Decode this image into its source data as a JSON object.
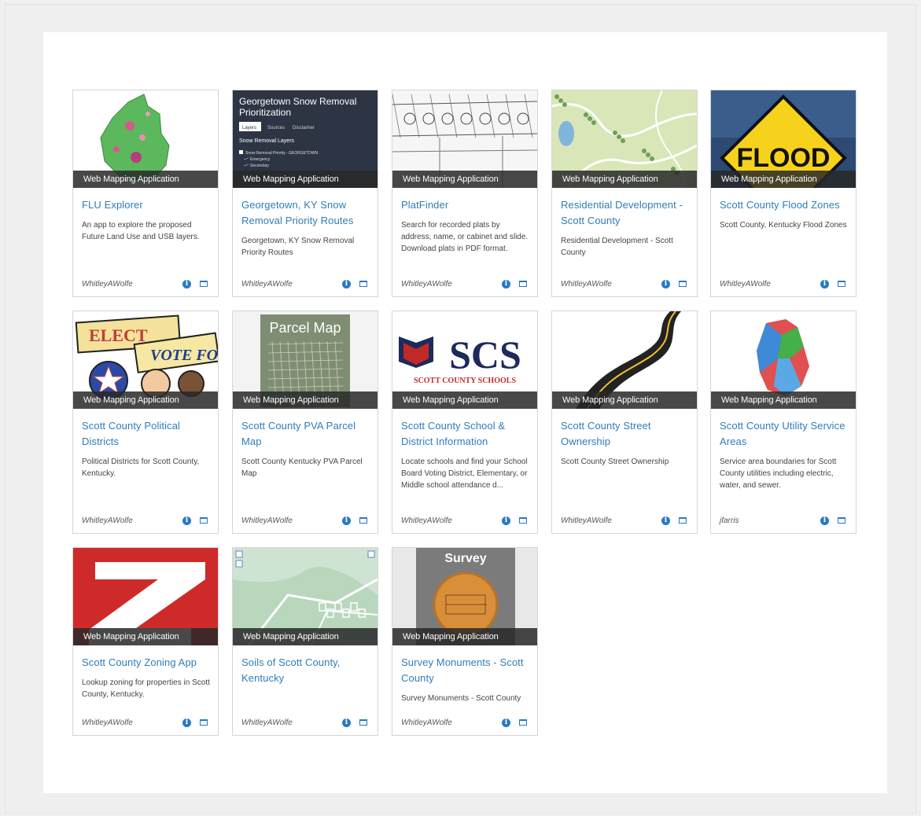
{
  "items": [
    {
      "type": "Web Mapping Application",
      "title": "FLU Explorer",
      "description": "An app to explore the proposed Future Land Use and USB layers.",
      "owner": "WhitleyAWolfe",
      "thumb": "flu-map"
    },
    {
      "type": "Web Mapping Application",
      "title": "Georgetown, KY Snow Removal Priority Routes",
      "description": "Georgetown, KY Snow Removal Priority Routes",
      "owner": "WhitleyAWolfe",
      "thumb": "snow-removal",
      "thumb_text": {
        "heading": "Georgetown Snow Removal Prioritization",
        "tabs": [
          "Layers",
          "Sources",
          "Disclaimer"
        ],
        "section": "Snow Removal Layers",
        "layer": "Snow Removal Priority - GEORGETOWN",
        "sublayers": [
          "Emergency",
          "Secondary"
        ]
      }
    },
    {
      "type": "Web Mapping Application",
      "title": "PlatFinder",
      "description": "Search for recorded plats by address, name, or cabinet and slide. Download plats in PDF format.",
      "owner": "WhitleyAWolfe",
      "thumb": "plat-drawing"
    },
    {
      "type": "Web Mapping Application",
      "title": "Residential Development - Scott County",
      "description": "Residential Development - Scott County",
      "owner": "WhitleyAWolfe",
      "thumb": "residential-map"
    },
    {
      "type": "Web Mapping Application",
      "title": "Scott County Flood Zones",
      "description": "Scott County, Kentucky Flood Zones",
      "owner": "WhitleyAWolfe",
      "thumb": "flood-sign",
      "thumb_text": {
        "sign": "FLOOD"
      }
    },
    {
      "type": "Web Mapping Application",
      "title": "Scott County Political Districts",
      "description": "Political Districts for Scott County, Kentucky.",
      "owner": "WhitleyAWolfe",
      "thumb": "elect-clipart",
      "thumb_text": {
        "sign1": "ELECT",
        "sign2": "VOTE FO"
      }
    },
    {
      "type": "Web Mapping Application",
      "title": "Scott County PVA Parcel Map",
      "description": "Scott County Kentucky PVA Parcel Map",
      "owner": "WhitleyAWolfe",
      "thumb": "parcel-map",
      "thumb_text": {
        "heading": "Parcel Map"
      }
    },
    {
      "type": "Web Mapping Application",
      "title": "Scott County School & District Information",
      "description": "Locate schools and find your School Board Voting District, Elementary, or Middle school attendance d...",
      "owner": "WhitleyAWolfe",
      "thumb": "scs-logo",
      "thumb_text": {
        "logo": "SCS",
        "sub": "SCOTT COUNTY SCHOOLS"
      }
    },
    {
      "type": "Web Mapping Application",
      "title": "Scott County Street Ownership",
      "description": "Scott County Street Ownership",
      "owner": "WhitleyAWolfe",
      "thumb": "road"
    },
    {
      "type": "Web Mapping Application",
      "title": "Scott County Utility Service Areas",
      "description": "Service area boundaries for Scott County utilities including electric, water, and sewer.",
      "owner": "jfarris",
      "thumb": "utility-map"
    },
    {
      "type": "Web Mapping Application",
      "title": "Scott County Zoning App",
      "description": "Lookup zoning for properties in Scott County, Kentucky.",
      "owner": "WhitleyAWolfe",
      "thumb": "zoning-z"
    },
    {
      "type": "Web Mapping Application",
      "title": "Soils of Scott County, Kentucky",
      "description": "",
      "owner": "WhitleyAWolfe",
      "thumb": "soils-map"
    },
    {
      "type": "Web Mapping Application",
      "title": "Survey Monuments - Scott County",
      "description": "Survey Monuments - Scott County",
      "owner": "WhitleyAWolfe",
      "thumb": "survey-monument",
      "thumb_text": {
        "heading": "Survey"
      }
    }
  ],
  "colors": {
    "link": "#2f7db9",
    "icon": "#2a78c5",
    "type_bar": "#333333"
  }
}
